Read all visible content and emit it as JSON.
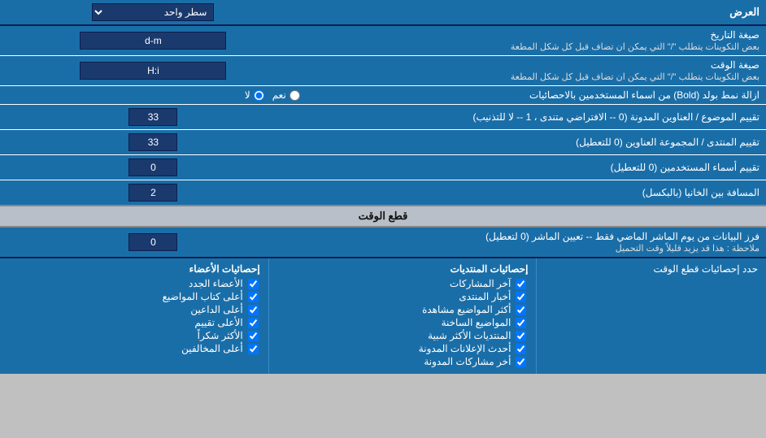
{
  "header": {
    "label": "العرض",
    "dropdown_label": "سطر واحد"
  },
  "date_format": {
    "label": "صيغة التاريخ",
    "note": "بعض التكوينات يتطلب \"/\" التي يمكن ان تضاف قبل كل شكل المطعة",
    "value": "d-m"
  },
  "time_format": {
    "label": "صيغة الوقت",
    "note": "بعض التكوينات يتطلب \"/\" التي يمكن ان تضاف قبل كل شكل المطعة",
    "value": "H:i"
  },
  "bold_remove": {
    "label": "ازالة نمط بولد (Bold) من اسماء المستخدمين بالاحصائيات",
    "option_yes": "نعم",
    "option_no": "لا",
    "selected": "no"
  },
  "topic_sort": {
    "label": "تقييم الموضوع / العناوين المدونة (0 -- الافتراضي متندى ، 1 -- لا للتذنيب)",
    "value": "33"
  },
  "forum_sort": {
    "label": "تقييم المنتدى / المجموعة العناوين (0 للتعطيل)",
    "value": "33"
  },
  "username_sort": {
    "label": "تقييم أسماء المستخدمين (0 للتعطيل)",
    "value": "0"
  },
  "gap": {
    "label": "المسافة بين الخانيا (بالبكسل)",
    "value": "2"
  },
  "time_cut_section": {
    "title": "قطع الوقت"
  },
  "time_cut": {
    "label": "فرز البيانات من يوم الماشر الماضي فقط -- تعيين الماشر (0 لتعطيل)",
    "note": "ملاحظة : هذا قد يزيد قليلاً وقت التحميل",
    "value": "0"
  },
  "stats_limit": {
    "label": "حدد إحصائيات قطع الوقت"
  },
  "checkboxes_posts": {
    "title": "إحصائيات المنتديات",
    "items": [
      "آخر المشاركات",
      "أخبار المنتدى",
      "أكثر المواضيع مشاهدة",
      "المواضيع الساخنة",
      "المنتديات الأكثر شبية",
      "أحدث الإعلانات المدونة",
      "أخر مشاركات المدونة"
    ]
  },
  "checkboxes_members": {
    "title": "إحصائيات الأعضاء",
    "items": [
      "الأعضاء الجدد",
      "أعلى كتاب المواضيع",
      "أعلى الداعين",
      "الأعلى تقييم",
      "الأكثر شكراً",
      "أعلى المخالفين"
    ]
  }
}
